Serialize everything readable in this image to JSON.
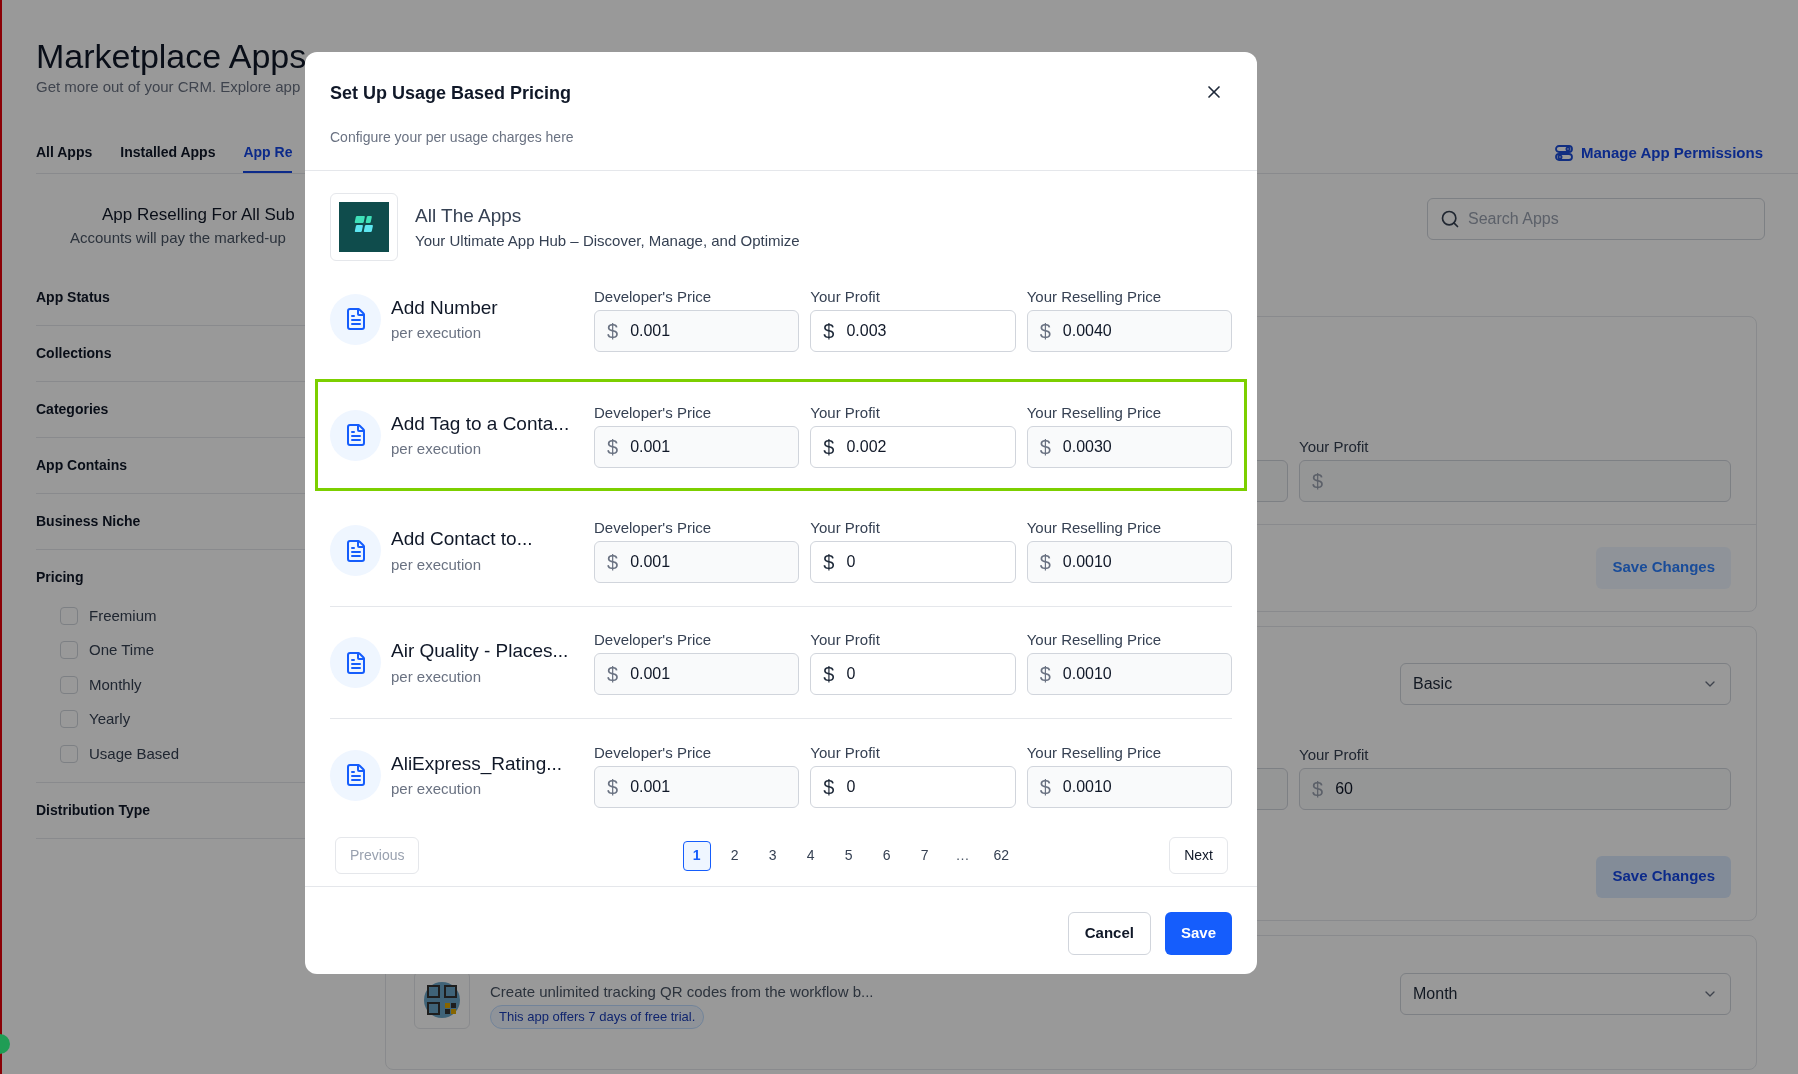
{
  "page": {
    "title": "Marketplace Apps",
    "subtitle": "Get more out of your CRM. Explore app"
  },
  "tabs": [
    {
      "label": "All Apps",
      "selected": false
    },
    {
      "label": "Installed Apps",
      "selected": false
    },
    {
      "label": "App Re",
      "selected": true
    }
  ],
  "manage_permissions": "Manage App Permissions",
  "reselling": {
    "title": "App Reselling For All Sub",
    "note": "Accounts will pay the marked-up"
  },
  "filters": [
    {
      "label": "App Status"
    },
    {
      "label": "Collections"
    },
    {
      "label": "Categories"
    },
    {
      "label": "App Contains"
    },
    {
      "label": "Business Niche"
    },
    {
      "label": "Pricing",
      "options": [
        {
          "label": "Freemium",
          "checked": false
        },
        {
          "label": "One Time",
          "checked": false
        },
        {
          "label": "Monthly",
          "checked": false
        },
        {
          "label": "Yearly",
          "checked": false
        },
        {
          "label": "Usage Based",
          "checked": false
        }
      ]
    },
    {
      "label": "Distribution Type"
    }
  ],
  "search": {
    "placeholder": "Search Apps"
  },
  "cards": [
    {
      "profit": {
        "label": "Your Profit",
        "currency": "$"
      },
      "save": {
        "label": "Save Changes",
        "disabled": true
      }
    },
    {
      "plan": "Basic",
      "profit": {
        "label": "Your Profit",
        "currency": "$",
        "value": "60"
      },
      "save": {
        "label": "Save Changes",
        "disabled": false
      }
    },
    {
      "period": "Month",
      "app": {
        "description": "Create unlimited tracking QR codes from the workflow b...",
        "trial": "This app offers 7 days of free trial."
      }
    }
  ],
  "modal": {
    "title": "Set Up Usage Based Pricing",
    "subtitle": "Configure your per usage charges here",
    "app": {
      "name": "All The Apps",
      "tagline": "Your Ultimate App Hub – Discover, Manage, and Optimize"
    },
    "rows": [
      {
        "name": "Add Number",
        "unit": "per execution",
        "highlighted": false,
        "fields": [
          {
            "label": "Developer's Price",
            "currency": "$",
            "value": "0.001",
            "disabled": true
          },
          {
            "label": "Your Profit",
            "currency": "$",
            "value": "0.003",
            "disabled": false
          },
          {
            "label": "Your Reselling Price",
            "currency": "$",
            "value": "0.0040",
            "disabled": true
          }
        ]
      },
      {
        "name": "Add Tag to a Conta...",
        "unit": "per execution",
        "highlighted": true,
        "fields": [
          {
            "label": "Developer's Price",
            "currency": "$",
            "value": "0.001",
            "disabled": true
          },
          {
            "label": "Your Profit",
            "currency": "$",
            "value": "0.002",
            "disabled": false
          },
          {
            "label": "Your Reselling Price",
            "currency": "$",
            "value": "0.0030",
            "disabled": true
          }
        ]
      },
      {
        "name": "Add Contact to...",
        "unit": "per execution",
        "highlighted": false,
        "fields": [
          {
            "label": "Developer's Price",
            "currency": "$",
            "value": "0.001",
            "disabled": true
          },
          {
            "label": "Your Profit",
            "currency": "$",
            "value": "0",
            "disabled": false
          },
          {
            "label": "Your Reselling Price",
            "currency": "$",
            "value": "0.0010",
            "disabled": true
          }
        ]
      },
      {
        "name": "Air Quality - Places...",
        "unit": "per execution",
        "highlighted": false,
        "fields": [
          {
            "label": "Developer's Price",
            "currency": "$",
            "value": "0.001",
            "disabled": true
          },
          {
            "label": "Your Profit",
            "currency": "$",
            "value": "0",
            "disabled": false
          },
          {
            "label": "Your Reselling Price",
            "currency": "$",
            "value": "0.0010",
            "disabled": true
          }
        ]
      },
      {
        "name": "AliExpress_Rating...",
        "unit": "per execution",
        "highlighted": false,
        "fields": [
          {
            "label": "Developer's Price",
            "currency": "$",
            "value": "0.001",
            "disabled": true
          },
          {
            "label": "Your Profit",
            "currency": "$",
            "value": "0",
            "disabled": false
          },
          {
            "label": "Your Reselling Price",
            "currency": "$",
            "value": "0.0010",
            "disabled": true
          }
        ]
      }
    ],
    "pagination": {
      "previous": {
        "label": "Previous",
        "disabled": true
      },
      "pages": [
        {
          "label": "1",
          "kind": "page",
          "selected": true
        },
        {
          "label": "2",
          "kind": "page",
          "selected": false
        },
        {
          "label": "3",
          "kind": "page",
          "selected": false
        },
        {
          "label": "4",
          "kind": "page",
          "selected": false
        },
        {
          "label": "5",
          "kind": "page",
          "selected": false
        },
        {
          "label": "6",
          "kind": "page",
          "selected": false
        },
        {
          "label": "7",
          "kind": "page",
          "selected": false
        },
        {
          "label": "…",
          "kind": "ellipsis",
          "selected": false
        },
        {
          "label": "62",
          "kind": "page",
          "selected": false
        }
      ],
      "next": {
        "label": "Next",
        "disabled": false
      }
    },
    "buttons": [
      {
        "label": "Cancel",
        "kind": "secondary"
      },
      {
        "label": "Save",
        "kind": "primary"
      }
    ]
  }
}
